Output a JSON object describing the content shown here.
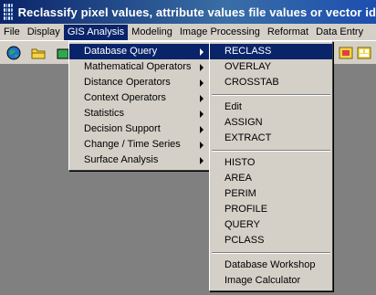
{
  "window": {
    "title": "Reclassify pixel values, attribute values file values or vector id"
  },
  "menubar": {
    "items": [
      "File",
      "Display",
      "GIS Analysis",
      "Modeling",
      "Image Processing",
      "Reformat",
      "Data Entry"
    ]
  },
  "gis_menu": {
    "items": [
      "Database Query",
      "Mathematical Operators",
      "Distance Operators",
      "Context Operators",
      "Statistics",
      "Decision Support",
      "Change / Time Series",
      "Surface Analysis"
    ]
  },
  "submenu": {
    "group1": [
      "RECLASS",
      "OVERLAY",
      "CROSSTAB"
    ],
    "group2": [
      "Edit",
      "ASSIGN",
      "EXTRACT"
    ],
    "group3": [
      "HISTO",
      "AREA",
      "PERIM",
      "PROFILE",
      "QUERY",
      "PCLASS"
    ],
    "group4": [
      "Database Workshop",
      "Image Calculator"
    ]
  },
  "colors": {
    "highlight": "#0a246a",
    "menu_bg": "#d4d0c8",
    "workspace": "#808080"
  }
}
